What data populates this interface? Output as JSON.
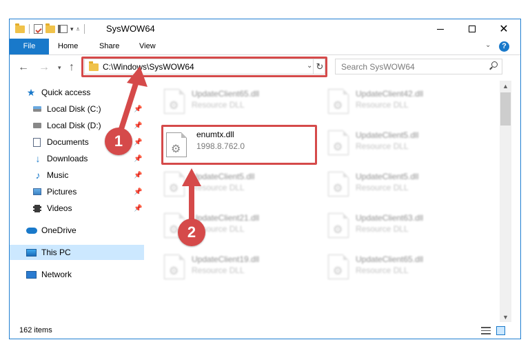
{
  "window": {
    "title": "SysWOW64",
    "colors": {
      "accent": "#1979ca",
      "highlight": "#d54a4a",
      "selected": "#cce8ff"
    }
  },
  "ribbon": {
    "tabs": [
      "File",
      "Home",
      "Share",
      "View"
    ]
  },
  "nav": {
    "address": "C:\\Windows\\SysWOW64",
    "search_placeholder": "Search SysWOW64"
  },
  "sidebar": {
    "items": [
      {
        "label": "Quick access",
        "icon": "star-icon"
      },
      {
        "label": "Local Disk (C:)",
        "icon": "drive-icon",
        "pinned": true
      },
      {
        "label": "Local Disk (D:)",
        "icon": "drive-icon",
        "pinned": true
      },
      {
        "label": "Documents",
        "icon": "documents-icon",
        "pinned": true
      },
      {
        "label": "Downloads",
        "icon": "download-icon",
        "pinned": true
      },
      {
        "label": "Music",
        "icon": "music-icon",
        "pinned": true
      },
      {
        "label": "Pictures",
        "icon": "pictures-icon",
        "pinned": true
      },
      {
        "label": "Videos",
        "icon": "videos-icon",
        "pinned": true
      },
      {
        "label": "OneDrive",
        "icon": "cloud-icon"
      },
      {
        "label": "This PC",
        "icon": "computer-icon",
        "selected": true
      },
      {
        "label": "Network",
        "icon": "network-icon"
      }
    ]
  },
  "files": {
    "focus": {
      "name": "enumtx.dll",
      "detail": "1998.8.762.0"
    },
    "blurred": [
      {
        "name": "UpdateClient65.dll",
        "type": "Resource DLL"
      },
      {
        "name": "UpdateClient42.dll",
        "type": "Resource DLL"
      },
      {
        "name": "UpdateClient5.dll",
        "type": "Resource DLL"
      },
      {
        "name": "UpdateClient5.dll",
        "type": "Resource DLL"
      },
      {
        "name": "UpdateClient5.dll",
        "type": "Resource DLL"
      },
      {
        "name": "UpdateClient21.dll",
        "type": "Resource DLL"
      },
      {
        "name": "UpdateClient63.dll",
        "type": "Resource DLL"
      },
      {
        "name": "UpdateClient19.dll",
        "type": "Resource DLL"
      },
      {
        "name": "UpdateClient65.dll",
        "type": "Resource DLL"
      }
    ]
  },
  "status": {
    "item_count": "162 items"
  },
  "annotations": {
    "step1": "1",
    "step2": "2"
  }
}
